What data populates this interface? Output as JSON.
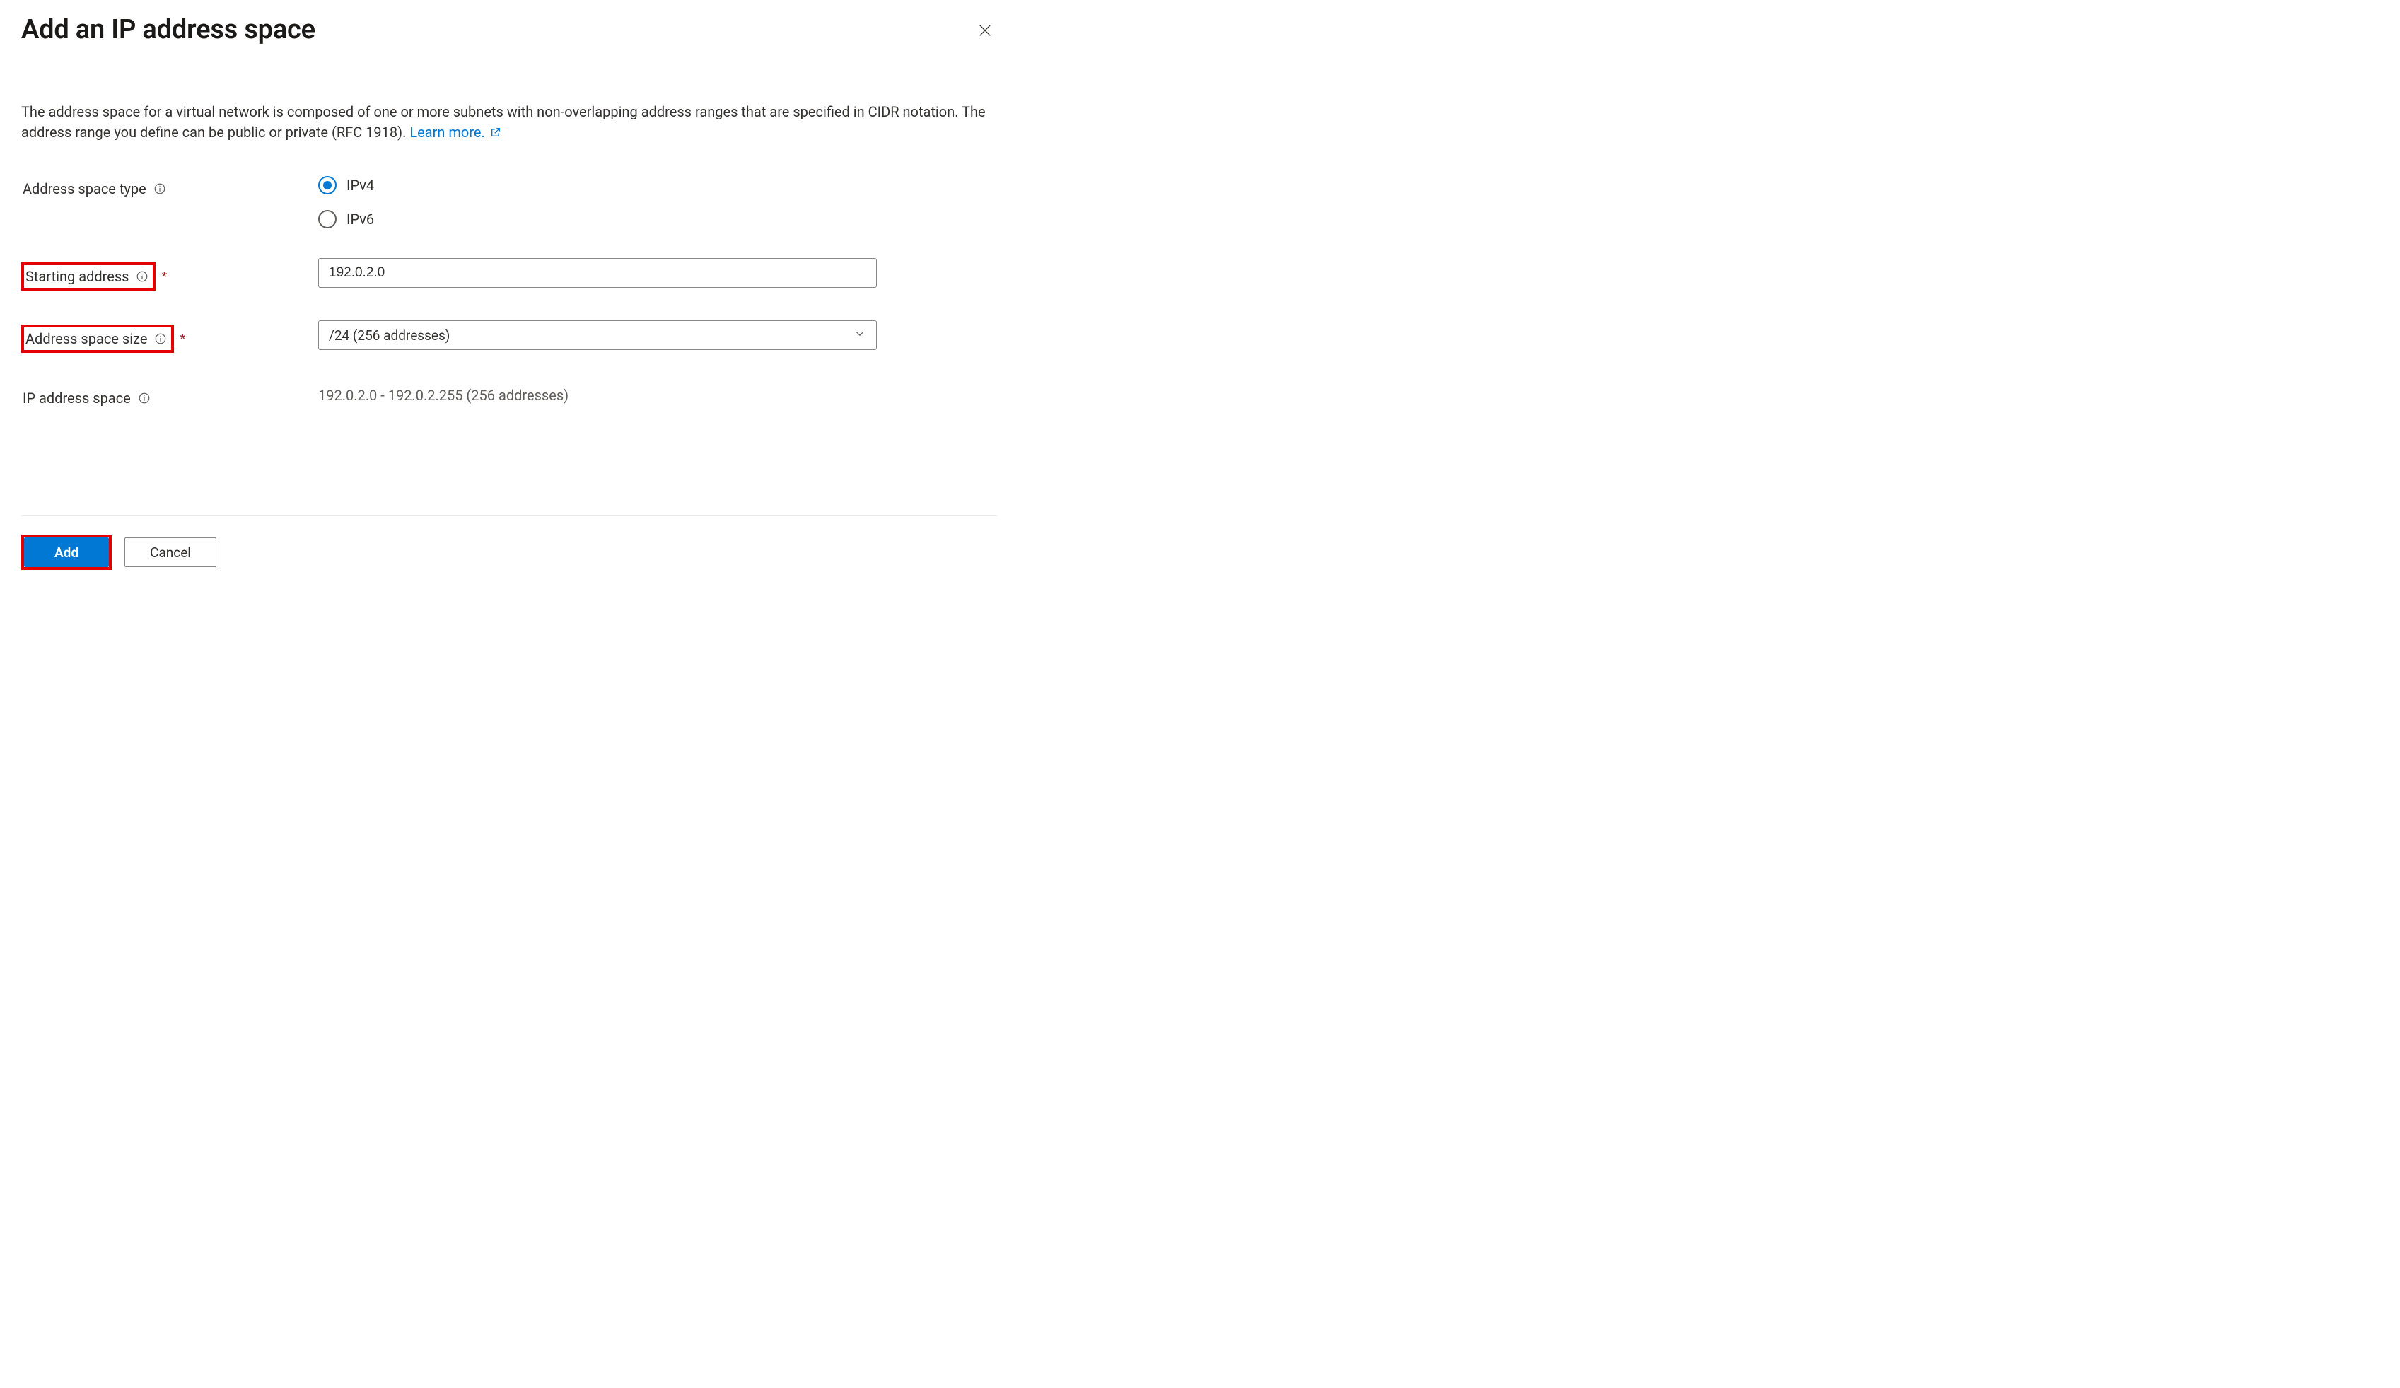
{
  "panel": {
    "title": "Add an IP address space",
    "description_prefix": "The address space for a virtual network is composed of one or more subnets with non-overlapping address ranges that are specified in CIDR notation. The address range you define can be public or private (RFC 1918). ",
    "learn_more_label": "Learn more."
  },
  "fields": {
    "address_space_type": {
      "label": "Address space type",
      "options": {
        "ipv4": "IPv4",
        "ipv6": "IPv6"
      },
      "selected": "ipv4"
    },
    "starting_address": {
      "label": "Starting address",
      "value": "192.0.2.0"
    },
    "address_space_size": {
      "label": "Address space size",
      "value": "/24 (256 addresses)"
    },
    "ip_address_space": {
      "label": "IP address space",
      "value": "192.0.2.0 - 192.0.2.255 (256 addresses)"
    }
  },
  "footer": {
    "add_label": "Add",
    "cancel_label": "Cancel"
  }
}
